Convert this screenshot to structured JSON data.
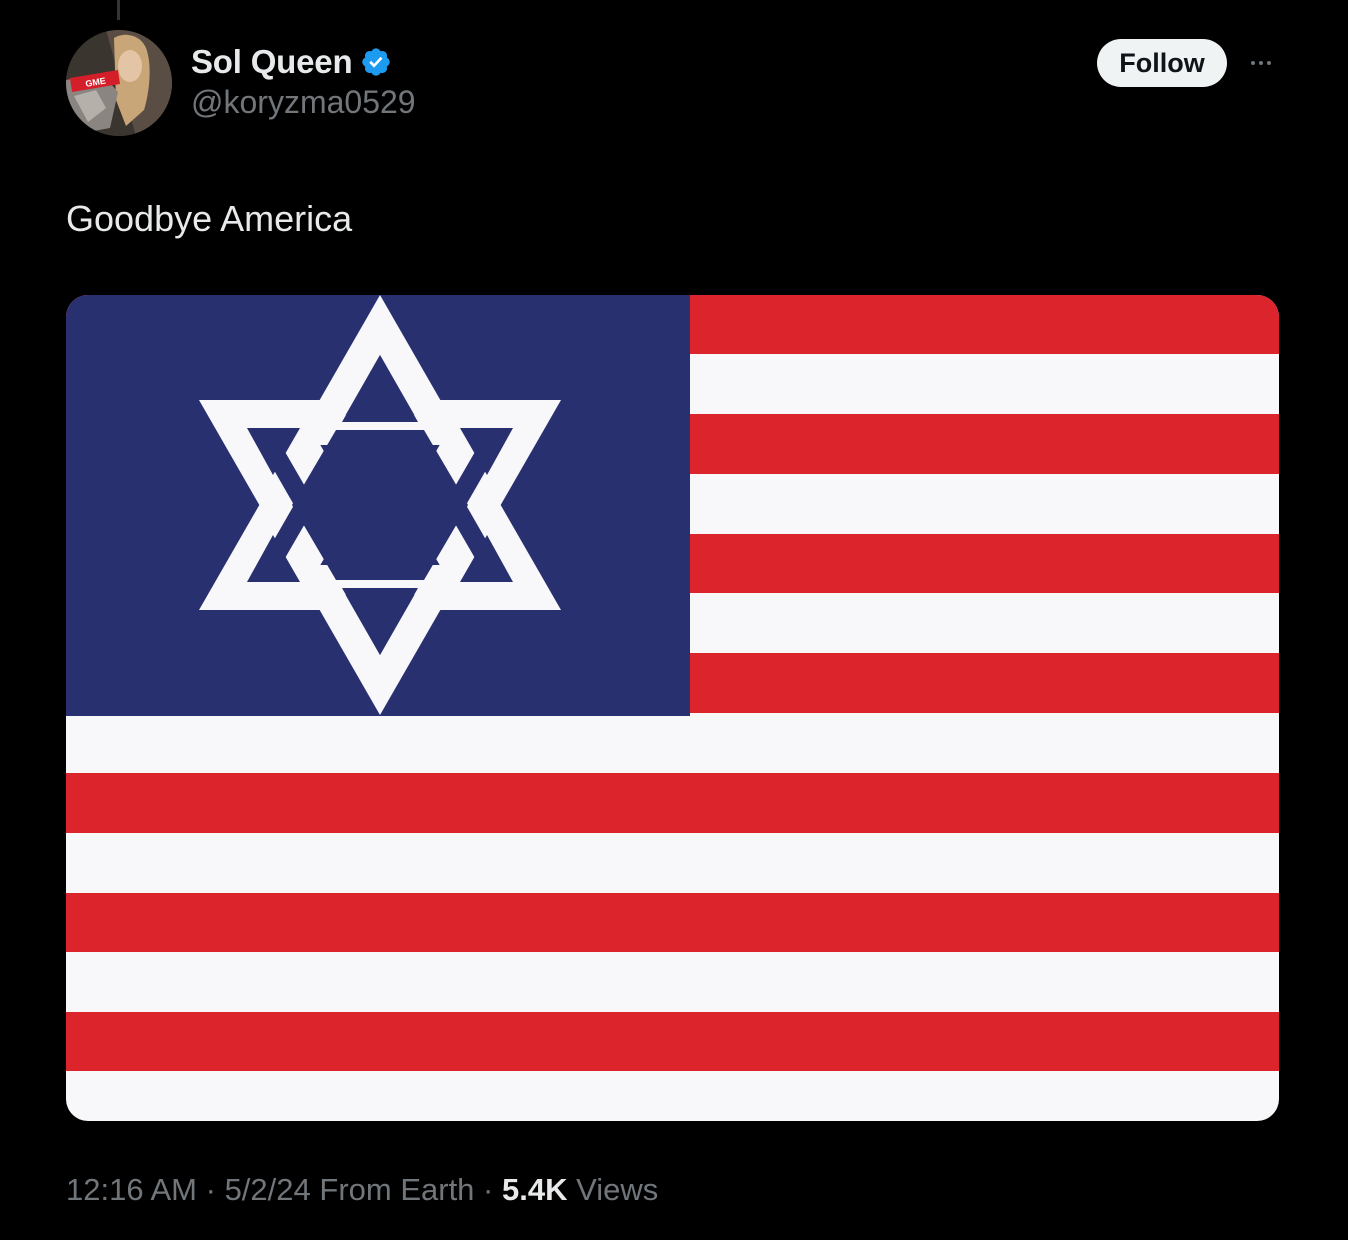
{
  "author": {
    "display_name": "Sol Queen",
    "handle": "@koryzma0529",
    "verified": true,
    "avatar_cap_text": "GME"
  },
  "actions": {
    "follow_label": "Follow"
  },
  "tweet": {
    "text": "Goodbye America",
    "time": "12:16 AM",
    "date": "5/2/24",
    "source": "From Earth",
    "views_count": "5.4K",
    "views_label": "Views",
    "separator": "·"
  },
  "colors": {
    "background": "#000000",
    "primary_text": "#e7e9ea",
    "secondary_text": "#71767b",
    "verified_blue": "#1d9bf0",
    "flag_red": "#dc242d",
    "flag_white": "#f8f8fa",
    "flag_blue": "#293070"
  },
  "icons": {
    "verified": "verified-badge-icon",
    "more": "more-options-icon"
  }
}
